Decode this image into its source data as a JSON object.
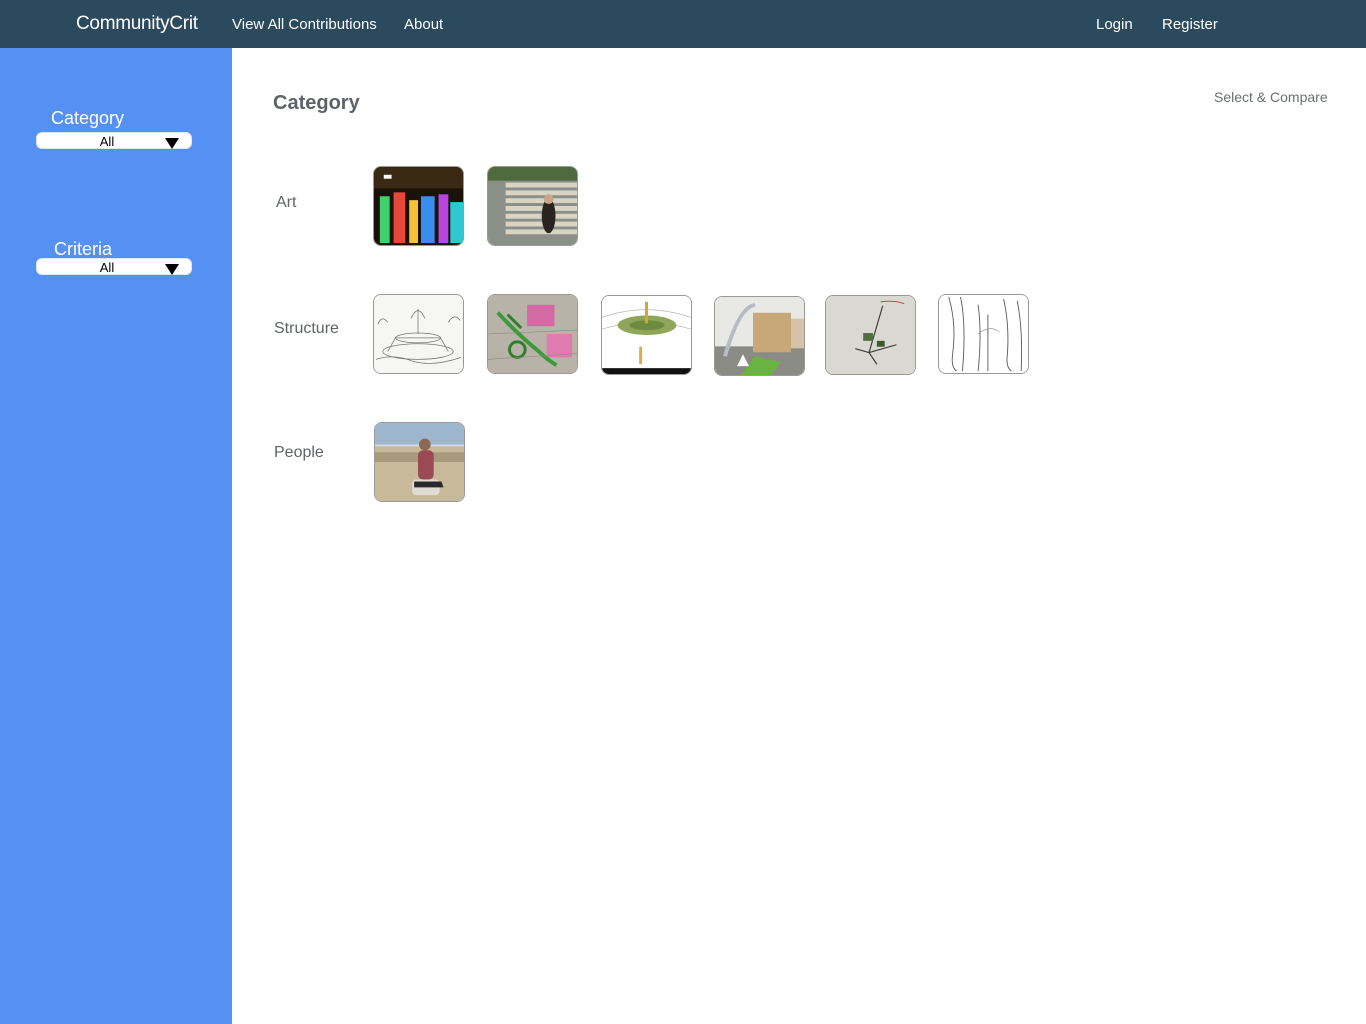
{
  "navbar": {
    "brand": "CommunityCrit",
    "links": [
      "View All Contributions",
      "About"
    ],
    "auth": [
      "Login",
      "Register"
    ]
  },
  "sidebar": {
    "category": {
      "label": "Category",
      "value": "All"
    },
    "criteria": {
      "label": "Criteria",
      "value": "All"
    }
  },
  "main": {
    "title": "Category",
    "compare": "Select & Compare",
    "rows": [
      {
        "label": "Art"
      },
      {
        "label": "Structure"
      },
      {
        "label": "People"
      }
    ]
  },
  "colors": {
    "navbar": "#2c4a5d",
    "sidebar": "#5590f3"
  },
  "icons": [
    "dropdown-caret-icon"
  ]
}
